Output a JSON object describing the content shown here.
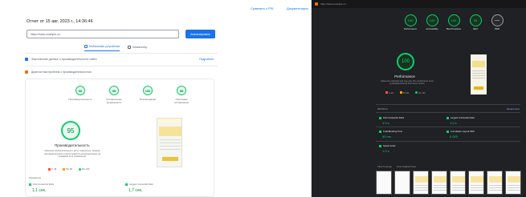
{
  "left": {
    "top_links": [
      "Сравнить с PSI",
      "Документация"
    ],
    "report_title": "Отчет от 15 авг. 2023 г., 14:36:46",
    "url_value": "https://www.example.ru/",
    "analyze_label": "Анализировать",
    "tabs": [
      "Мобильные устройства",
      "Компьютер"
    ],
    "sections": [
      "Фактические данные о производительности сайта",
      "Диагностика проблем с производительностью"
    ],
    "section_link": "Подробнее",
    "gauges": [
      {
        "score": "96",
        "label": "Производительность"
      },
      {
        "score": "95",
        "label": "Специальные возможности"
      },
      {
        "score": "100",
        "label": "Рекомендации"
      },
      {
        "score": "98",
        "label": "Поисковая оптимизация"
      }
    ],
    "big_score": "95",
    "perf_title": "Производительность",
    "perf_desc": "Значения приблизительные и могут изменяться. Уровень производительности рассчитывается непосредственно на основании этих показателей.",
    "legend": [
      "0–49",
      "50–89",
      "90–100"
    ],
    "metrics_label": "Показатели",
    "metrics": [
      {
        "name": "First Contentful Paint",
        "value": "1,1 сек."
      },
      {
        "name": "Largest Contentful Paint",
        "value": "1,7 сек."
      }
    ]
  },
  "right": {
    "tab_text": "https://www.example.ru/",
    "gauges": [
      {
        "score": "100",
        "label": "Performance"
      },
      {
        "score": "100",
        "label": "Accessibility"
      },
      {
        "score": "100",
        "label": "Best Practices"
      },
      {
        "score": "95",
        "label": "SEO"
      },
      {
        "score": "—",
        "label": "PWA"
      }
    ],
    "big_score": "100",
    "perf_title": "Performance",
    "perf_desc": "Values are estimated and may vary. The performance score is calculated directly from these metrics.",
    "legend": [
      "0–49",
      "50–89",
      "90–100"
    ],
    "metrics_heading": "METRICS",
    "metrics_link": "Expand view",
    "metrics": [
      {
        "name": "First Contentful Paint",
        "value": "1.0 s"
      },
      {
        "name": "Largest Contentful Paint",
        "value": "1.0 s"
      },
      {
        "name": "Total Blocking Time",
        "value": "50 ms"
      },
      {
        "name": "Cumulative Layout Shift",
        "value": "0.003"
      },
      {
        "name": "Speed Index",
        "value": "1.0 s"
      }
    ],
    "view_options": [
      "View Treemap",
      "View Original Trace"
    ]
  },
  "colors": {
    "good": "#0cce6b",
    "link": "#1a73e8",
    "dark_bg": "#202124"
  }
}
